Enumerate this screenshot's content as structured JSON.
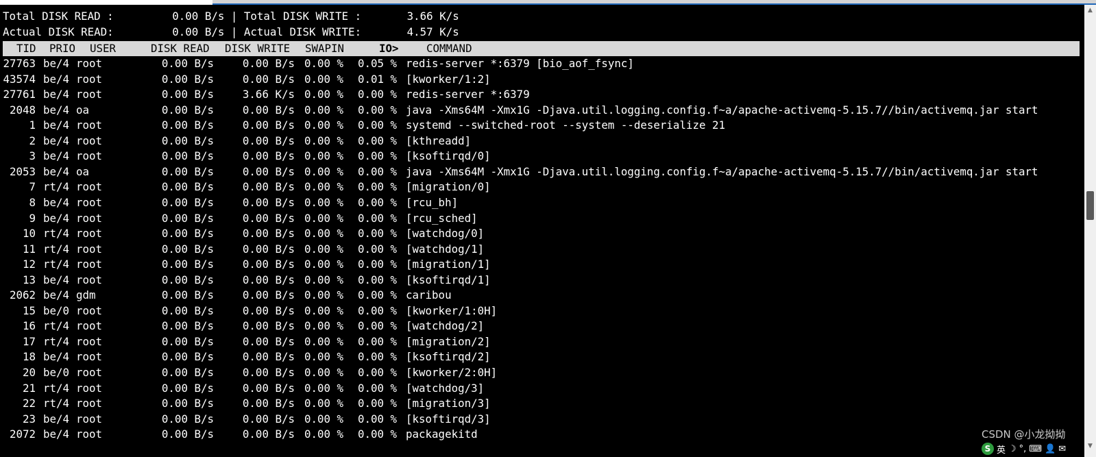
{
  "summary": {
    "total_read": "Total DISK READ :         0.00 B/s | Total DISK WRITE :       3.66 K/s",
    "actual_read": "Actual DISK READ:         0.00 B/s | Actual DISK WRITE:       4.57 K/s"
  },
  "columns": {
    "tid": "TID",
    "prio": "PRIO",
    "user": "USER",
    "disk_read": "DISK READ",
    "disk_write": "DISK WRITE",
    "swapin": "SWAPIN",
    "io": "IO>",
    "command": "COMMAND"
  },
  "rows": [
    {
      "tid": "27763",
      "prio": "be/4",
      "user": "root",
      "read": "0.00 B/s",
      "write": "0.00 B/s",
      "swapin": "0.00 %",
      "io": "0.05 %",
      "command": "redis-server *:6379 [bio_aof_fsync]"
    },
    {
      "tid": "43574",
      "prio": "be/4",
      "user": "root",
      "read": "0.00 B/s",
      "write": "0.00 B/s",
      "swapin": "0.00 %",
      "io": "0.01 %",
      "command": "[kworker/1:2]"
    },
    {
      "tid": "27761",
      "prio": "be/4",
      "user": "root",
      "read": "0.00 B/s",
      "write": "3.66 K/s",
      "swapin": "0.00 %",
      "io": "0.00 %",
      "command": "redis-server *:6379"
    },
    {
      "tid": "2048",
      "prio": "be/4",
      "user": "oa",
      "read": "0.00 B/s",
      "write": "0.00 B/s",
      "swapin": "0.00 %",
      "io": "0.00 %",
      "command": "java -Xms64M -Xmx1G -Djava.util.logging.config.f~a/apache-activemq-5.15.7//bin/activemq.jar start"
    },
    {
      "tid": "1",
      "prio": "be/4",
      "user": "root",
      "read": "0.00 B/s",
      "write": "0.00 B/s",
      "swapin": "0.00 %",
      "io": "0.00 %",
      "command": "systemd --switched-root --system --deserialize 21"
    },
    {
      "tid": "2",
      "prio": "be/4",
      "user": "root",
      "read": "0.00 B/s",
      "write": "0.00 B/s",
      "swapin": "0.00 %",
      "io": "0.00 %",
      "command": "[kthreadd]"
    },
    {
      "tid": "3",
      "prio": "be/4",
      "user": "root",
      "read": "0.00 B/s",
      "write": "0.00 B/s",
      "swapin": "0.00 %",
      "io": "0.00 %",
      "command": "[ksoftirqd/0]"
    },
    {
      "tid": "2053",
      "prio": "be/4",
      "user": "oa",
      "read": "0.00 B/s",
      "write": "0.00 B/s",
      "swapin": "0.00 %",
      "io": "0.00 %",
      "command": "java -Xms64M -Xmx1G -Djava.util.logging.config.f~a/apache-activemq-5.15.7//bin/activemq.jar start"
    },
    {
      "tid": "7",
      "prio": "rt/4",
      "user": "root",
      "read": "0.00 B/s",
      "write": "0.00 B/s",
      "swapin": "0.00 %",
      "io": "0.00 %",
      "command": "[migration/0]"
    },
    {
      "tid": "8",
      "prio": "be/4",
      "user": "root",
      "read": "0.00 B/s",
      "write": "0.00 B/s",
      "swapin": "0.00 %",
      "io": "0.00 %",
      "command": "[rcu_bh]"
    },
    {
      "tid": "9",
      "prio": "be/4",
      "user": "root",
      "read": "0.00 B/s",
      "write": "0.00 B/s",
      "swapin": "0.00 %",
      "io": "0.00 %",
      "command": "[rcu_sched]"
    },
    {
      "tid": "10",
      "prio": "rt/4",
      "user": "root",
      "read": "0.00 B/s",
      "write": "0.00 B/s",
      "swapin": "0.00 %",
      "io": "0.00 %",
      "command": "[watchdog/0]"
    },
    {
      "tid": "11",
      "prio": "rt/4",
      "user": "root",
      "read": "0.00 B/s",
      "write": "0.00 B/s",
      "swapin": "0.00 %",
      "io": "0.00 %",
      "command": "[watchdog/1]"
    },
    {
      "tid": "12",
      "prio": "rt/4",
      "user": "root",
      "read": "0.00 B/s",
      "write": "0.00 B/s",
      "swapin": "0.00 %",
      "io": "0.00 %",
      "command": "[migration/1]"
    },
    {
      "tid": "13",
      "prio": "be/4",
      "user": "root",
      "read": "0.00 B/s",
      "write": "0.00 B/s",
      "swapin": "0.00 %",
      "io": "0.00 %",
      "command": "[ksoftirqd/1]"
    },
    {
      "tid": "2062",
      "prio": "be/4",
      "user": "gdm",
      "read": "0.00 B/s",
      "write": "0.00 B/s",
      "swapin": "0.00 %",
      "io": "0.00 %",
      "command": "caribou"
    },
    {
      "tid": "15",
      "prio": "be/0",
      "user": "root",
      "read": "0.00 B/s",
      "write": "0.00 B/s",
      "swapin": "0.00 %",
      "io": "0.00 %",
      "command": "[kworker/1:0H]"
    },
    {
      "tid": "16",
      "prio": "rt/4",
      "user": "root",
      "read": "0.00 B/s",
      "write": "0.00 B/s",
      "swapin": "0.00 %",
      "io": "0.00 %",
      "command": "[watchdog/2]"
    },
    {
      "tid": "17",
      "prio": "rt/4",
      "user": "root",
      "read": "0.00 B/s",
      "write": "0.00 B/s",
      "swapin": "0.00 %",
      "io": "0.00 %",
      "command": "[migration/2]"
    },
    {
      "tid": "18",
      "prio": "be/4",
      "user": "root",
      "read": "0.00 B/s",
      "write": "0.00 B/s",
      "swapin": "0.00 %",
      "io": "0.00 %",
      "command": "[ksoftirqd/2]"
    },
    {
      "tid": "20",
      "prio": "be/0",
      "user": "root",
      "read": "0.00 B/s",
      "write": "0.00 B/s",
      "swapin": "0.00 %",
      "io": "0.00 %",
      "command": "[kworker/2:0H]"
    },
    {
      "tid": "21",
      "prio": "rt/4",
      "user": "root",
      "read": "0.00 B/s",
      "write": "0.00 B/s",
      "swapin": "0.00 %",
      "io": "0.00 %",
      "command": "[watchdog/3]"
    },
    {
      "tid": "22",
      "prio": "rt/4",
      "user": "root",
      "read": "0.00 B/s",
      "write": "0.00 B/s",
      "swapin": "0.00 %",
      "io": "0.00 %",
      "command": "[migration/3]"
    },
    {
      "tid": "23",
      "prio": "be/4",
      "user": "root",
      "read": "0.00 B/s",
      "write": "0.00 B/s",
      "swapin": "0.00 %",
      "io": "0.00 %",
      "command": "[ksoftirqd/3]"
    },
    {
      "tid": "2072",
      "prio": "be/4",
      "user": "root",
      "read": "0.00 B/s",
      "write": "0.00 B/s",
      "swapin": "0.00 %",
      "io": "0.00 %",
      "command": "packagekitd"
    }
  ],
  "watermark": "CSDN @小龙拗拗",
  "ime": {
    "logo": "S",
    "lang": "英",
    "items": [
      "☽",
      "°,",
      "⌨",
      "👤",
      "✉"
    ]
  },
  "colors": {
    "background": "#000000",
    "text": "#ffffff",
    "header_bar": "#d8d8d8",
    "tab_accent": "#1f66b8"
  }
}
